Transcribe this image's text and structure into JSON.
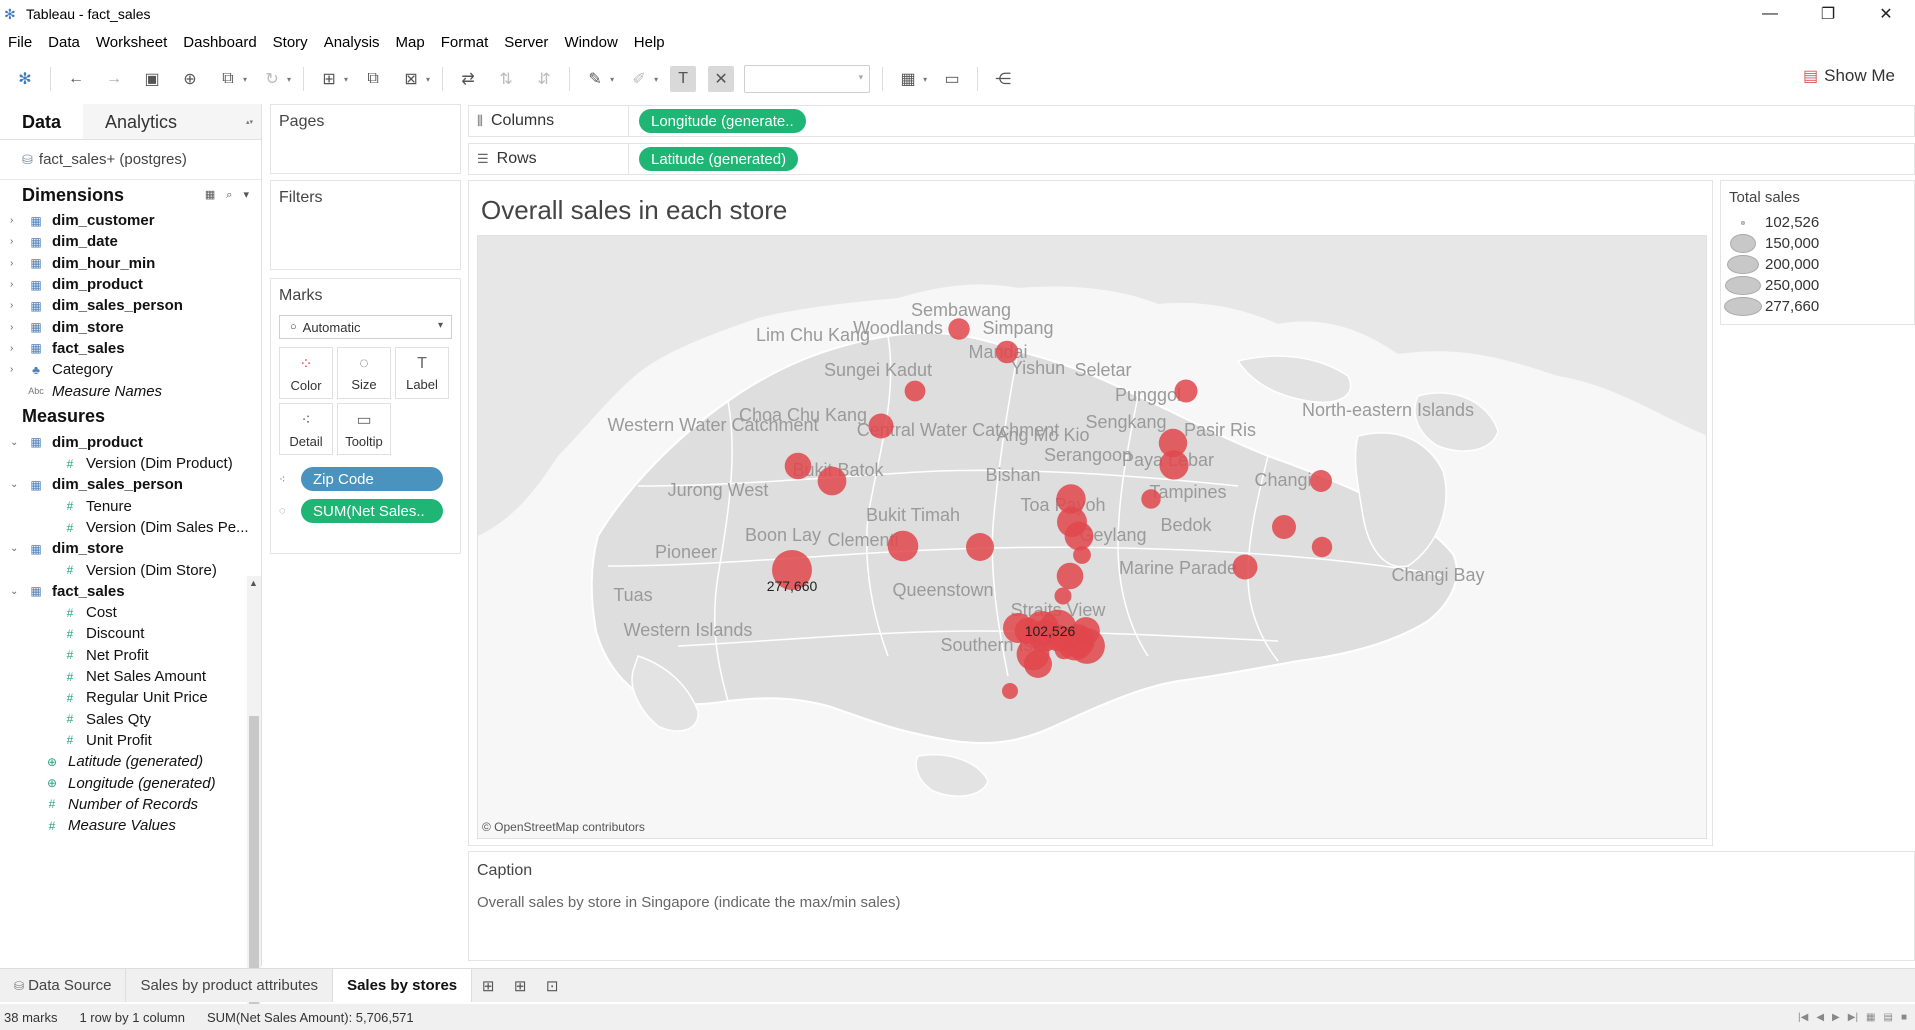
{
  "window": {
    "title": "Tableau - fact_sales",
    "controls": [
      "—",
      "❐",
      "✕"
    ]
  },
  "menu": [
    "File",
    "Data",
    "Worksheet",
    "Dashboard",
    "Story",
    "Analysis",
    "Map",
    "Format",
    "Server",
    "Window",
    "Help"
  ],
  "toolbar": {
    "show_me": "Show Me"
  },
  "data_pane": {
    "tabs": [
      "Data",
      "Analytics"
    ],
    "datasource": "fact_sales+ (postgres)",
    "dimensions_header": "Dimensions",
    "dimensions": [
      {
        "label": "dim_customer",
        "kind": "table"
      },
      {
        "label": "dim_date",
        "kind": "table"
      },
      {
        "label": "dim_hour_min",
        "kind": "table"
      },
      {
        "label": "dim_product",
        "kind": "table"
      },
      {
        "label": "dim_sales_person",
        "kind": "table"
      },
      {
        "label": "dim_store",
        "kind": "table"
      },
      {
        "label": "fact_sales",
        "kind": "table"
      },
      {
        "label": "Category",
        "kind": "hier"
      },
      {
        "label": "Measure Names",
        "kind": "abc"
      }
    ],
    "measures_header": "Measures",
    "measures": [
      {
        "label": "dim_product",
        "kind": "table"
      },
      {
        "label": "Version (Dim Product)",
        "kind": "meas"
      },
      {
        "label": "dim_sales_person",
        "kind": "table"
      },
      {
        "label": "Tenure",
        "kind": "meas"
      },
      {
        "label": "Version (Dim Sales Pe...",
        "kind": "meas"
      },
      {
        "label": "dim_store",
        "kind": "table"
      },
      {
        "label": "Version (Dim Store)",
        "kind": "meas"
      },
      {
        "label": "fact_sales",
        "kind": "table"
      },
      {
        "label": "Cost",
        "kind": "meas"
      },
      {
        "label": "Discount",
        "kind": "meas"
      },
      {
        "label": "Net Profit",
        "kind": "meas"
      },
      {
        "label": "Net Sales Amount",
        "kind": "meas"
      },
      {
        "label": "Regular Unit Price",
        "kind": "meas"
      },
      {
        "label": "Sales Qty",
        "kind": "meas"
      },
      {
        "label": "Unit Profit",
        "kind": "meas"
      },
      {
        "label": "Latitude (generated)",
        "kind": "gen"
      },
      {
        "label": "Longitude (generated)",
        "kind": "gen"
      },
      {
        "label": "Number of Records",
        "kind": "gen"
      },
      {
        "label": "Measure Values",
        "kind": "gen"
      }
    ]
  },
  "cards": {
    "pages": "Pages",
    "filters": "Filters",
    "marks": "Marks",
    "mark_type": "Automatic",
    "mark_buttons": [
      "Color",
      "Size",
      "Label",
      "Detail",
      "Tooltip"
    ],
    "pills": [
      "Zip Code",
      "SUM(Net Sales.."
    ]
  },
  "shelves": {
    "columns_label": "Columns",
    "columns_pill": "Longitude (generate..",
    "rows_label": "Rows",
    "rows_pill": "Latitude (generated)"
  },
  "viz": {
    "title": "Overall sales in each store",
    "attribution": "© OpenStreetMap contributors",
    "place_names": [
      "Sembawang",
      "Simpang",
      "Woodlands",
      "Mandai",
      "Lim Chu Kang",
      "Sungei Kadut",
      "Yishun",
      "Seletar",
      "Punggol",
      "Sengkang",
      "Pasir Ris",
      "North-eastern Islands",
      "Western Water Catchment",
      "Choa Chu Kang",
      "Central Water Catchment",
      "Ang Mo Kio",
      "Serangoon",
      "Paya Lebar",
      "Tampines",
      "Changi",
      "Jurong West",
      "Bukit Batok",
      "Bishan",
      "Toa Payoh",
      "Bukit Timah",
      "Geylang",
      "Bedok",
      "Boon Lay",
      "Clementi",
      "Pioneer",
      "Marine Parade",
      "Changi Bay",
      "Tuas",
      "Queenstown",
      "Straits View",
      "Western Islands",
      "Southern Islands"
    ],
    "data_labels": [
      "277,660",
      "102,526"
    ]
  },
  "chart_data": {
    "type": "scatter",
    "title": "Overall sales in each store",
    "mark_encoding": "size = SUM(Net Sales Amount), one mark per Zip Code",
    "mark_count": 38,
    "labeled_points": [
      {
        "name": "max",
        "value": 277660
      },
      {
        "name": "min",
        "value": 102526
      }
    ],
    "size_legend": {
      "title": "Total sales",
      "values": [
        102526,
        150000,
        200000,
        250000,
        277660
      ],
      "labels": [
        "102,526",
        "150,000",
        "200,000",
        "250,000",
        "277,660"
      ]
    },
    "total": 5706571,
    "color": "#e0474c"
  },
  "caption": {
    "title": "Caption",
    "text": "Overall sales by store in Singapore (indicate the max/min sales)"
  },
  "sheet_tabs": {
    "data_source": "Data Source",
    "sheets": [
      "Sales by product attributes",
      "Sales by stores"
    ]
  },
  "status": {
    "marks": "38 marks",
    "layout": "1 row by 1 column",
    "sum": "SUM(Net Sales Amount): 5,706,571"
  }
}
